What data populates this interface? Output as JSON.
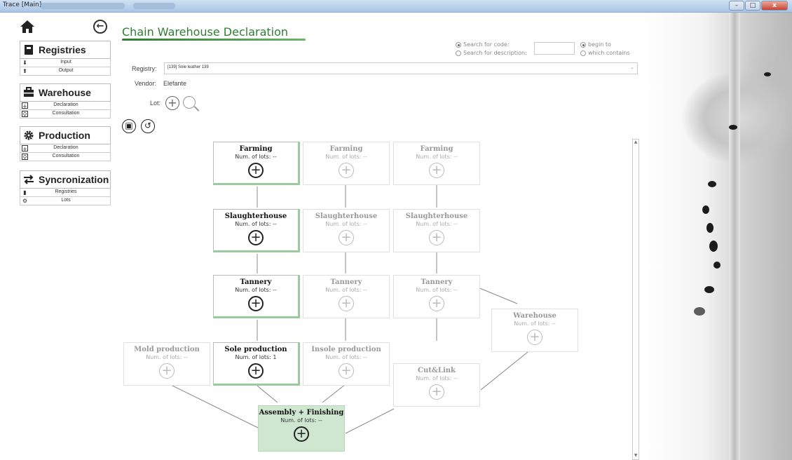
{
  "window": {
    "title": "Trace [Main]",
    "buttons": [
      "–",
      "□",
      "x"
    ]
  },
  "sidebar": {
    "sections": [
      {
        "label": "Registries",
        "icon": "book-icon",
        "items": [
          {
            "label": "Input",
            "icon": "arrow-down-icon"
          },
          {
            "label": "Output",
            "icon": "arrow-up-icon"
          }
        ]
      },
      {
        "label": "Warehouse",
        "icon": "briefcase-icon",
        "items": [
          {
            "label": "Declaration",
            "icon": "plus-box-icon"
          },
          {
            "label": "Consultation",
            "icon": "search-box-icon"
          }
        ]
      },
      {
        "label": "Production",
        "icon": "gear-icon",
        "items": [
          {
            "label": "Declaration",
            "icon": "plus-box-icon"
          },
          {
            "label": "Consultation",
            "icon": "search-box-icon"
          }
        ]
      },
      {
        "label": "Syncronization",
        "icon": "sync-arrows-icon",
        "items": [
          {
            "label": "Registries",
            "icon": "book-icon"
          },
          {
            "label": "Lots",
            "icon": "gear-icon"
          }
        ]
      }
    ]
  },
  "main": {
    "title": "Chain Warehouse Declaration",
    "search": {
      "by_code": "Search for code:",
      "by_description": "Search for description:",
      "begin_to": "begin to",
      "which_contains": "which contains",
      "code_value": ""
    },
    "registry_label": "Registry:",
    "registry_value": "[139] Sole leather 139",
    "vendor_label": "Vendor:",
    "vendor_value": "Elefante",
    "lot_label": "Lot:",
    "add_symbol": "+",
    "lots_label": "Num. of lots: --",
    "nodes": {
      "farming_1": {
        "title": "Farming",
        "lots": "Num. of lots: --"
      },
      "farming_2": {
        "title": "Farming",
        "lots": "Num. of lots: --"
      },
      "farming_3": {
        "title": "Farming",
        "lots": "Num. of lots: --"
      },
      "slaughter_1": {
        "title": "Slaughterhouse",
        "lots": "Num. of lots: --"
      },
      "slaughter_2": {
        "title": "Slaughterhouse",
        "lots": "Num. of lots: --"
      },
      "slaughter_3": {
        "title": "Slaughterhouse",
        "lots": "Num. of lots: --"
      },
      "tannery_1": {
        "title": "Tannery",
        "lots": "Num. of lots: --"
      },
      "tannery_2": {
        "title": "Tannery",
        "lots": "Num. of lots: --"
      },
      "tannery_3": {
        "title": "Tannery",
        "lots": "Num. of lots: --"
      },
      "warehouse": {
        "title": "Warehouse",
        "lots": "Num. of lots: --"
      },
      "mold": {
        "title": "Mold production",
        "lots": "Num. of lots: --"
      },
      "sole": {
        "title": "Sole production",
        "lots": "Num. of lots: 1"
      },
      "insole": {
        "title": "Insole production",
        "lots": "Num. of lots: --"
      },
      "cutlink": {
        "title": "Cut&Link",
        "lots": "Num. of lots: --"
      },
      "assembly": {
        "title": "Assembly + Finishing",
        "lots": "Num. of lots: --"
      }
    }
  },
  "colors": {
    "accent": "#2f7d32",
    "final_node": "#cfe6d1",
    "active_border": "#9cca9e"
  }
}
